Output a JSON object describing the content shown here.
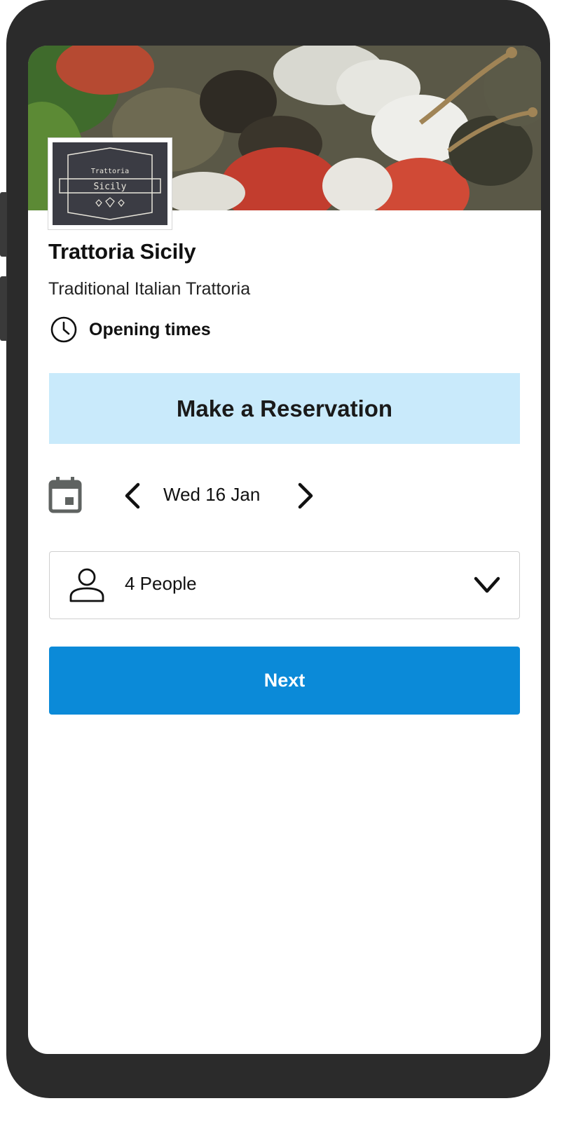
{
  "restaurant": {
    "logo_top_text": "Trattoria",
    "logo_main_text": "Sicily",
    "name": "Trattoria Sicily",
    "tagline": "Traditional Italian Trattoria"
  },
  "opening_times": {
    "label": "Opening times",
    "icon": "clock-icon"
  },
  "reservation": {
    "title": "Make a Reservation",
    "date_label": "Wed 16 Jan",
    "party_size_label": "4 People",
    "next_label": "Next"
  },
  "icons": {
    "calendar": "calendar-icon",
    "prev": "chevron-left-icon",
    "next": "chevron-right-icon",
    "person": "person-icon",
    "dropdown": "chevron-down-icon"
  },
  "colors": {
    "banner_bg": "#c9eafb",
    "button_bg": "#0b8ad8",
    "phone_frame": "#2b2b2b"
  }
}
